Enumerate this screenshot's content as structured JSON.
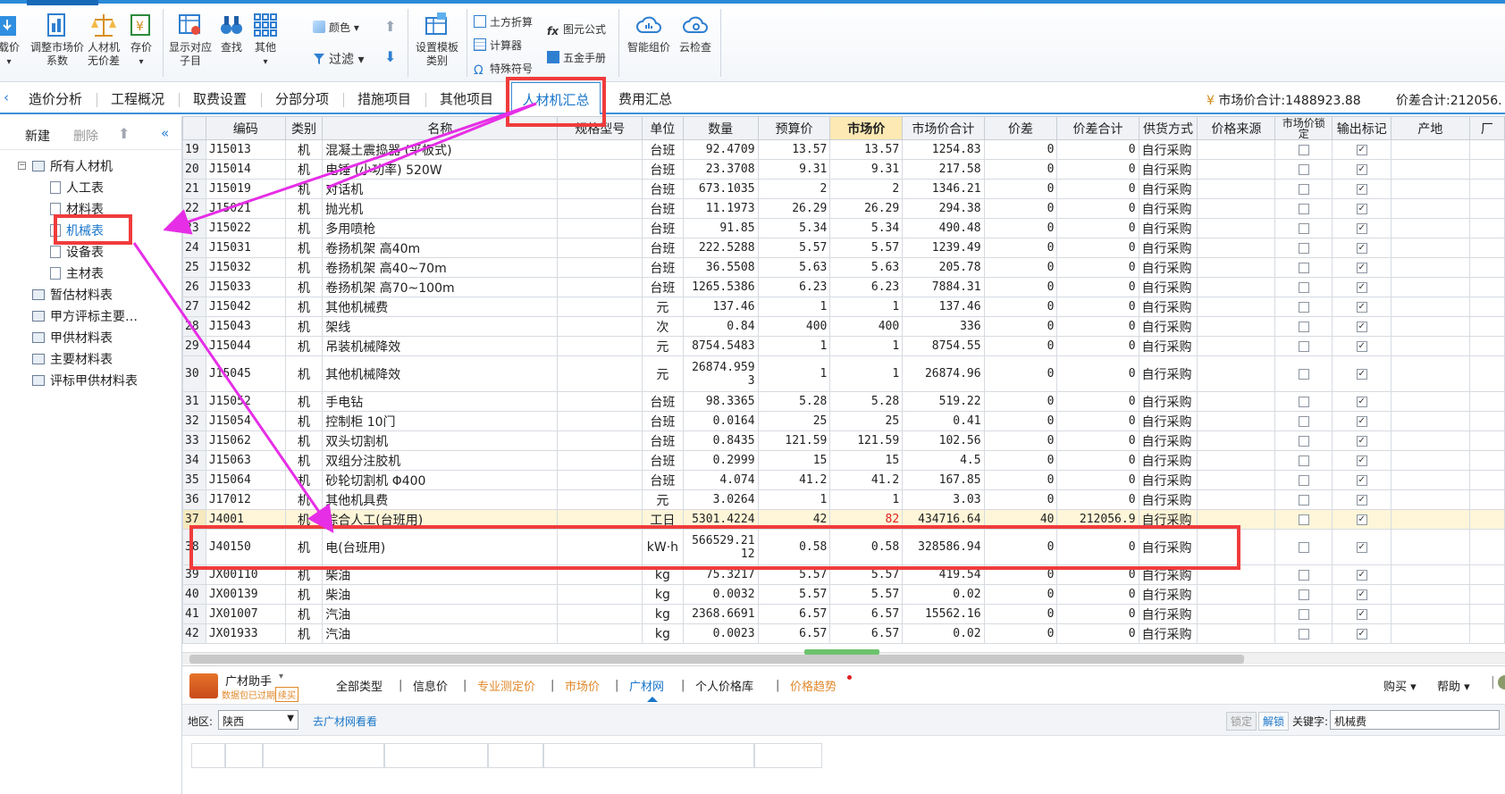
{
  "toolbar": {
    "buttons": [
      {
        "label1": "载价",
        "label2": ""
      },
      {
        "label1": "调整市场价",
        "label2": "系数"
      },
      {
        "label1": "人材机",
        "label2": "无价差"
      },
      {
        "label1": "存价",
        "label2": ""
      },
      {
        "label1": "显示对应",
        "label2": "子目"
      },
      {
        "label1": "查找",
        "label2": ""
      },
      {
        "label1": "其他",
        "label2": ""
      },
      {
        "label1": "设置模板",
        "label2": "类别"
      },
      {
        "label1": "智能组价",
        "label2": ""
      },
      {
        "label1": "云检查",
        "label2": ""
      }
    ],
    "color_label": "颜色",
    "filter_label": "过滤",
    "small": {
      "earthwork": "土方折算",
      "calculator": "计算器",
      "special_symbol": "特殊符号",
      "formula": "图元公式",
      "hardware_manual": "五金手册"
    }
  },
  "tabs": [
    "造价分析",
    "工程概况",
    "取费设置",
    "分部分项",
    "措施项目",
    "其他项目",
    "人材机汇总",
    "费用汇总"
  ],
  "active_tab": "人材机汇总",
  "totals": {
    "market_total": "市场价合计:1488923.88",
    "diff_total": "价差合计:212056."
  },
  "left_panel": {
    "new_label": "新建",
    "delete_label": "删除",
    "tree": [
      {
        "label": "所有人材机"
      },
      {
        "label": "人工表"
      },
      {
        "label": "材料表"
      },
      {
        "label": "机械表"
      },
      {
        "label": "设备表"
      },
      {
        "label": "主材表"
      },
      {
        "label": "暂估材料表"
      },
      {
        "label": "甲方评标主要…"
      },
      {
        "label": "甲供材料表"
      },
      {
        "label": "主要材料表"
      },
      {
        "label": "评标甲供材料表"
      }
    ]
  },
  "grid": {
    "columns": [
      "",
      "编码",
      "类别",
      "名称",
      "规格型号",
      "单位",
      "数量",
      "预算价",
      "市场价",
      "市场价合计",
      "价差",
      "价差合计",
      "供货方式",
      "价格来源",
      "市场价锁定",
      "输出标记",
      "产地",
      "厂"
    ],
    "rows": [
      {
        "n": "19",
        "code": "J15013",
        "cat": "机",
        "name": "混凝土震捣器 (平板式)",
        "unit": "台班",
        "qty": "92.4709",
        "budget": "13.57",
        "market": "13.57",
        "mtotal": "1254.83",
        "diff": "0",
        "dtotal": "0",
        "supply": "自行采购"
      },
      {
        "n": "20",
        "code": "J15014",
        "cat": "机",
        "name": "电锤 (小功率) 520W",
        "unit": "台班",
        "qty": "23.3708",
        "budget": "9.31",
        "market": "9.31",
        "mtotal": "217.58",
        "diff": "0",
        "dtotal": "0",
        "supply": "自行采购"
      },
      {
        "n": "21",
        "code": "J15019",
        "cat": "机",
        "name": "对话机",
        "unit": "台班",
        "qty": "673.1035",
        "budget": "2",
        "market": "2",
        "mtotal": "1346.21",
        "diff": "0",
        "dtotal": "0",
        "supply": "自行采购"
      },
      {
        "n": "22",
        "code": "J15021",
        "cat": "机",
        "name": "抛光机",
        "unit": "台班",
        "qty": "11.1973",
        "budget": "26.29",
        "market": "26.29",
        "mtotal": "294.38",
        "diff": "0",
        "dtotal": "0",
        "supply": "自行采购"
      },
      {
        "n": "23",
        "code": "J15022",
        "cat": "机",
        "name": "多用喷枪",
        "unit": "台班",
        "qty": "91.85",
        "budget": "5.34",
        "market": "5.34",
        "mtotal": "490.48",
        "diff": "0",
        "dtotal": "0",
        "supply": "自行采购"
      },
      {
        "n": "24",
        "code": "J15031",
        "cat": "机",
        "name": "卷扬机架 高40m",
        "unit": "台班",
        "qty": "222.5288",
        "budget": "5.57",
        "market": "5.57",
        "mtotal": "1239.49",
        "diff": "0",
        "dtotal": "0",
        "supply": "自行采购"
      },
      {
        "n": "25",
        "code": "J15032",
        "cat": "机",
        "name": "卷扬机架 高40~70m",
        "unit": "台班",
        "qty": "36.5508",
        "budget": "5.63",
        "market": "5.63",
        "mtotal": "205.78",
        "diff": "0",
        "dtotal": "0",
        "supply": "自行采购"
      },
      {
        "n": "26",
        "code": "J15033",
        "cat": "机",
        "name": "卷扬机架 高70~100m",
        "unit": "台班",
        "qty": "1265.5386",
        "budget": "6.23",
        "market": "6.23",
        "mtotal": "7884.31",
        "diff": "0",
        "dtotal": "0",
        "supply": "自行采购"
      },
      {
        "n": "27",
        "code": "J15042",
        "cat": "机",
        "name": "其他机械费",
        "unit": "元",
        "qty": "137.46",
        "budget": "1",
        "market": "1",
        "mtotal": "137.46",
        "diff": "0",
        "dtotal": "0",
        "supply": "自行采购"
      },
      {
        "n": "28",
        "code": "J15043",
        "cat": "机",
        "name": "架线",
        "unit": "次",
        "qty": "0.84",
        "budget": "400",
        "market": "400",
        "mtotal": "336",
        "diff": "0",
        "dtotal": "0",
        "supply": "自行采购"
      },
      {
        "n": "29",
        "code": "J15044",
        "cat": "机",
        "name": "吊装机械降效",
        "unit": "元",
        "qty": "8754.5483",
        "budget": "1",
        "market": "1",
        "mtotal": "8754.55",
        "diff": "0",
        "dtotal": "0",
        "supply": "自行采购"
      },
      {
        "n": "30",
        "code": "J15045",
        "cat": "机",
        "name": "其他机械降效",
        "unit": "元",
        "qty": "26874.9593",
        "budget": "1",
        "market": "1",
        "mtotal": "26874.96",
        "diff": "0",
        "dtotal": "0",
        "supply": "自行采购"
      },
      {
        "n": "31",
        "code": "J15052",
        "cat": "机",
        "name": "手电钻",
        "unit": "台班",
        "qty": "98.3365",
        "budget": "5.28",
        "market": "5.28",
        "mtotal": "519.22",
        "diff": "0",
        "dtotal": "0",
        "supply": "自行采购"
      },
      {
        "n": "32",
        "code": "J15054",
        "cat": "机",
        "name": "控制柜 10门",
        "unit": "台班",
        "qty": "0.0164",
        "budget": "25",
        "market": "25",
        "mtotal": "0.41",
        "diff": "0",
        "dtotal": "0",
        "supply": "自行采购"
      },
      {
        "n": "33",
        "code": "J15062",
        "cat": "机",
        "name": "双头切割机",
        "unit": "台班",
        "qty": "0.8435",
        "budget": "121.59",
        "market": "121.59",
        "mtotal": "102.56",
        "diff": "0",
        "dtotal": "0",
        "supply": "自行采购"
      },
      {
        "n": "34",
        "code": "J15063",
        "cat": "机",
        "name": "双组分注胶机",
        "unit": "台班",
        "qty": "0.2999",
        "budget": "15",
        "market": "15",
        "mtotal": "4.5",
        "diff": "0",
        "dtotal": "0",
        "supply": "自行采购"
      },
      {
        "n": "35",
        "code": "J15064",
        "cat": "机",
        "name": "砂轮切割机 Φ400",
        "unit": "台班",
        "qty": "4.074",
        "budget": "41.2",
        "market": "41.2",
        "mtotal": "167.85",
        "diff": "0",
        "dtotal": "0",
        "supply": "自行采购"
      },
      {
        "n": "36",
        "code": "J17012",
        "cat": "机",
        "name": "其他机具费",
        "unit": "元",
        "qty": "3.0264",
        "budget": "1",
        "market": "1",
        "mtotal": "3.03",
        "diff": "0",
        "dtotal": "0",
        "supply": "自行采购"
      },
      {
        "n": "37",
        "code": "J4001",
        "cat": "机",
        "name": "综合人工(台班用)",
        "unit": "工日",
        "qty": "5301.4224",
        "budget": "42",
        "market": "82",
        "mtotal": "434716.64",
        "diff": "40",
        "dtotal": "212056.9",
        "supply": "自行采购"
      },
      {
        "n": "38",
        "code": "J40150",
        "cat": "机",
        "name": "电(台班用)",
        "unit": "kW·h",
        "qty": "566529.2112",
        "budget": "0.58",
        "market": "0.58",
        "mtotal": "328586.94",
        "diff": "0",
        "dtotal": "0",
        "supply": "自行采购"
      },
      {
        "n": "39",
        "code": "JX00110",
        "cat": "机",
        "name": "柴油",
        "unit": "kg",
        "qty": "75.3217",
        "budget": "5.57",
        "market": "5.57",
        "mtotal": "419.54",
        "diff": "0",
        "dtotal": "0",
        "supply": "自行采购"
      },
      {
        "n": "40",
        "code": "JX00139",
        "cat": "机",
        "name": "柴油",
        "unit": "kg",
        "qty": "0.0032",
        "budget": "5.57",
        "market": "5.57",
        "mtotal": "0.02",
        "diff": "0",
        "dtotal": "0",
        "supply": "自行采购"
      },
      {
        "n": "41",
        "code": "JX01007",
        "cat": "机",
        "name": "汽油",
        "unit": "kg",
        "qty": "2368.6691",
        "budget": "6.57",
        "market": "6.57",
        "mtotal": "15562.16",
        "diff": "0",
        "dtotal": "0",
        "supply": "自行采购"
      },
      {
        "n": "42",
        "code": "JX01933",
        "cat": "机",
        "name": "汽油",
        "unit": "kg",
        "qty": "0.0023",
        "budget": "6.57",
        "market": "6.57",
        "mtotal": "0.02",
        "diff": "0",
        "dtotal": "0",
        "supply": "自行采购"
      }
    ],
    "wrapped": {
      "r30_qty_a": "26874.959",
      "r30_qty_b": "3",
      "r38_qty_a": "566529.21",
      "r38_qty_b": "12"
    }
  },
  "bottom": {
    "assistant_title": "广材助手",
    "assistant_sub": "数据包已过期",
    "renew_label": "续买",
    "tabs": [
      "全部类型",
      "信息价",
      "专业测定价",
      "市场价",
      "广材网",
      "个人价格库",
      "价格趋势"
    ],
    "buy_label": "购买",
    "help_label": "帮助",
    "region_label": "地区:",
    "region_value": "陕西",
    "goto_link": "去广材网看看",
    "lock_label": "锁定",
    "unlock_label": "解锁",
    "keyword_label": "关键字:",
    "keyword_value": "机械费"
  },
  "colors": {
    "accent": "#1a76c9",
    "annotation_red": "#f03c3c",
    "arrow_magenta": "#e62ee6",
    "highlight_row": "#fff6d9"
  }
}
